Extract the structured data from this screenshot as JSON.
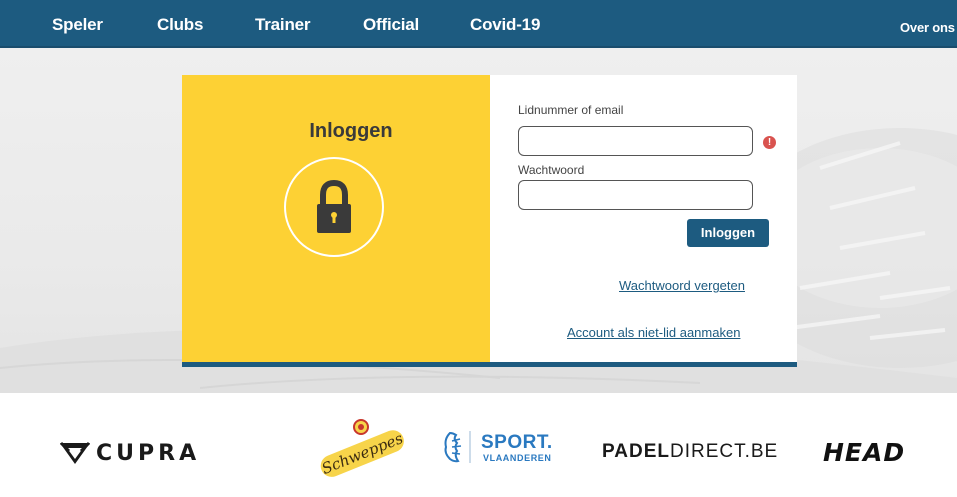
{
  "nav": {
    "items": [
      "Speler",
      "Clubs",
      "Trainer",
      "Official",
      "Covid-19"
    ],
    "right_item": "Over ons"
  },
  "login": {
    "title": "Inloggen",
    "username_label": "Lidnummer of email",
    "username_value": "",
    "password_label": "Wachtwoord",
    "password_value": "",
    "error_indicator": "!",
    "submit_label": "Inloggen",
    "forgot_password_link": "Wachtwoord vergeten",
    "create_account_link": "Account als niet-lid aanmaken"
  },
  "sponsors": {
    "cupra": "CUPRA",
    "schweppes": "Schweppes",
    "sport_vlaanderen_top": "SPORT.",
    "sport_vlaanderen_bottom": "VLAANDEREN",
    "padel_bold": "PADEL",
    "padel_light": "DIRECT.BE",
    "head": "HEAD"
  },
  "colors": {
    "nav_bg": "#1d5b80",
    "card_yellow": "#fdd134",
    "button": "#1d5b80",
    "error": "#d9534f"
  },
  "icons": {
    "lock": "lock-icon",
    "error": "error-icon"
  }
}
